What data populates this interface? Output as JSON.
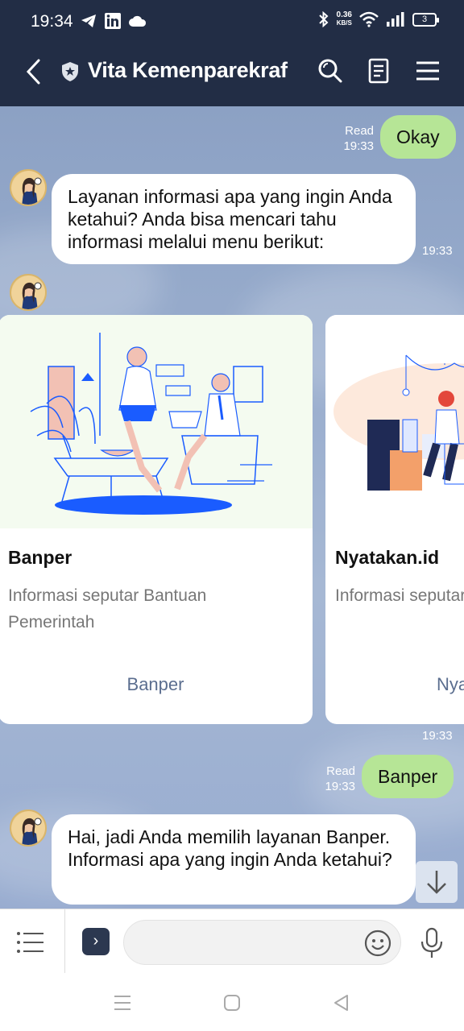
{
  "status_bar": {
    "time": "19:34",
    "net_speed_value": "0.36",
    "net_speed_unit": "KB/S",
    "battery": "3"
  },
  "header": {
    "title": "Vita Kemenparekraf"
  },
  "messages": {
    "m1": {
      "text": "Okay",
      "read": "Read",
      "time": "19:33"
    },
    "m2": {
      "text": "Layanan informasi apa yang ingin Anda ketahui? Anda bisa mencari tahu informasi melalui menu berikut:",
      "time": "19:33"
    },
    "carousel_time": "19:33",
    "m4": {
      "text": "Banper",
      "read": "Read",
      "time": "19:33"
    },
    "m5": {
      "text": "Hai, jadi Anda memilih layanan Banper. Informasi apa yang ingin Anda ketahui?"
    }
  },
  "carousel": [
    {
      "title": "Banper",
      "description": "Informasi seputar Bantuan Pemerintah",
      "action": "Banper"
    },
    {
      "title": "Nyatakan.id",
      "description": "Informasi seputar",
      "action": "Nya"
    }
  ],
  "input": {
    "placeholder": ""
  },
  "colors": {
    "header_bg": "#222d45",
    "my_bubble": "#b6e596",
    "bot_bubble": "#ffffff",
    "chat_bg": "#98acd0",
    "accent_blue": "#1a5cff"
  }
}
